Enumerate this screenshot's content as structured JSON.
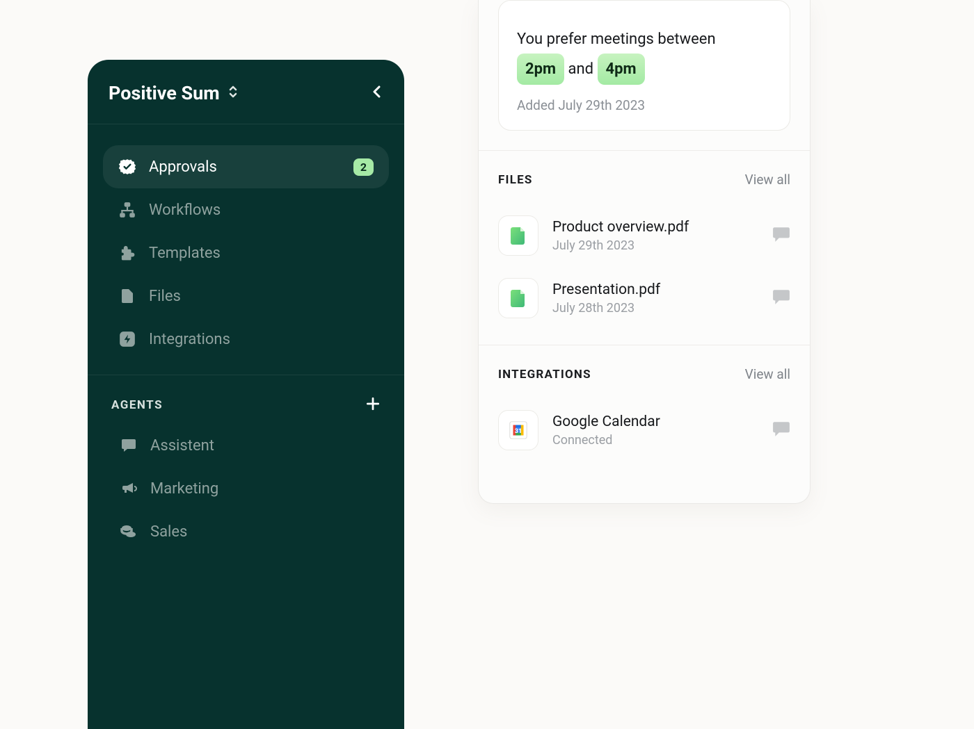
{
  "sidebar": {
    "title": "Positive Sum",
    "nav": [
      {
        "label": "Approvals",
        "badge": "2",
        "active": true
      },
      {
        "label": "Workflows",
        "badge": null,
        "active": false
      },
      {
        "label": "Templates",
        "badge": null,
        "active": false
      },
      {
        "label": "Files",
        "badge": null,
        "active": false
      },
      {
        "label": "Integrations",
        "badge": null,
        "active": false
      }
    ],
    "agents_section": {
      "title": "AGENTS",
      "items": [
        {
          "label": "Assistent"
        },
        {
          "label": "Marketing"
        },
        {
          "label": "Sales"
        }
      ]
    }
  },
  "panel": {
    "preference": {
      "prefix": "You prefer meetings between",
      "time_a": "2pm",
      "joiner": "and",
      "time_b": "4pm",
      "added": "Added July 29th 2023"
    },
    "files": {
      "title": "FILES",
      "view_all": "View all",
      "items": [
        {
          "name": "Product overview.pdf",
          "date": "July 29th 2023"
        },
        {
          "name": "Presentation.pdf",
          "date": "July 28th 2023"
        }
      ]
    },
    "integrations": {
      "title": "INTEGRATIONS",
      "view_all": "View all",
      "items": [
        {
          "name": "Google Calendar",
          "status": "Connected"
        }
      ]
    }
  }
}
